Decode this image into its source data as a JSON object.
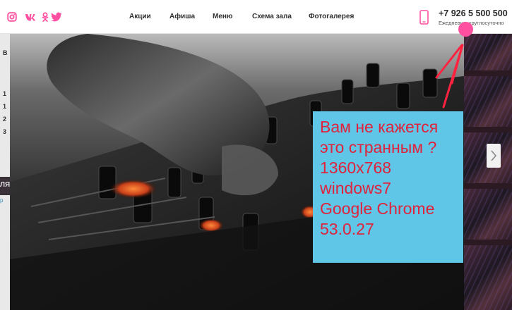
{
  "header": {
    "social": [
      "instagram-icon",
      "vk-icon",
      "odnoklassniki-icon",
      "twitter-icon"
    ],
    "social_color": "#ff4fa1",
    "nav": [
      "Акции",
      "Афиша",
      "Меню",
      "Схема зала",
      "Фотогалерея"
    ],
    "phone": "+7 926 5 500 500",
    "phone_hours": "Ежедневно, круглосуточно"
  },
  "left_edge": {
    "chars": [
      "В",
      "1",
      "1",
      "2",
      "3"
    ],
    "band_text": "ЛЯ",
    "sub_text": "р"
  },
  "annotation": {
    "lines": [
      "Вам не кажется",
      "это странным ?",
      "1360x768",
      "windows7",
      "Google Chrome",
      "53.0.27"
    ],
    "text_color": "#e0223b",
    "box_color": "#5fc6e8"
  },
  "colors": {
    "accent": "#ff4fa1",
    "dark": "#2a1c22"
  }
}
